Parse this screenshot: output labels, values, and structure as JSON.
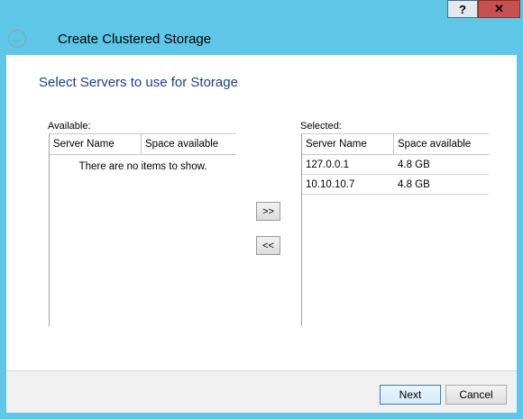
{
  "window": {
    "title": "Create Clustered Storage",
    "help_label": "?",
    "close_label": "✕",
    "back_glyph": "←"
  },
  "page": {
    "heading": "Select Servers to use for Storage"
  },
  "available": {
    "label": "Available:",
    "columns": [
      "Server Name",
      "Space available"
    ],
    "empty_text": "There are no items to show."
  },
  "selected": {
    "label": "Selected:",
    "columns": [
      "Server Name",
      "Space available"
    ],
    "rows": [
      {
        "name": "127.0.0.1",
        "space": "4.8 GB"
      },
      {
        "name": "10.10.10.7",
        "space": "4.8 GB"
      }
    ]
  },
  "transfer": {
    "add_label": ">>",
    "remove_label": "<<"
  },
  "footer": {
    "next_label": "Next",
    "cancel_label": "Cancel"
  },
  "colors": {
    "frame": "#5ec6e6",
    "heading": "#1e3e8a",
    "close_button": "#c75050"
  }
}
